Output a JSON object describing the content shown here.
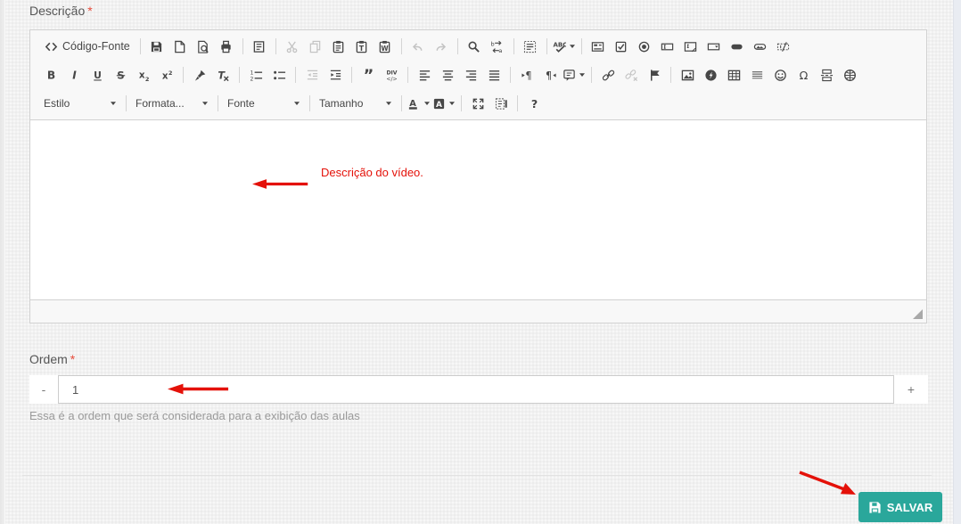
{
  "colors": {
    "accent_teal": "#2aa79b",
    "annotation_red": "#e41109",
    "required_red": "#e74c3c"
  },
  "description_field": {
    "label": "Descrição",
    "required_mark": "*"
  },
  "editor": {
    "annotation_text": "Descrição do vídeo.",
    "toolbar": {
      "rows": [
        [
          [
            {
              "name": "source",
              "label": "Código-Fonte"
            }
          ],
          [
            {
              "name": "save"
            },
            {
              "name": "new-page"
            },
            {
              "name": "preview"
            },
            {
              "name": "print"
            }
          ],
          [
            {
              "name": "templates"
            }
          ],
          [
            {
              "name": "cut",
              "disabled": true
            },
            {
              "name": "copy",
              "disabled": true
            },
            {
              "name": "paste"
            },
            {
              "name": "paste-text"
            },
            {
              "name": "paste-word"
            }
          ],
          [
            {
              "name": "undo",
              "disabled": true
            },
            {
              "name": "redo",
              "disabled": true
            }
          ],
          [
            {
              "name": "find"
            },
            {
              "name": "replace"
            }
          ],
          [
            {
              "name": "select-all"
            }
          ],
          [
            {
              "name": "spell-check",
              "caret": true
            }
          ],
          [
            {
              "name": "form"
            },
            {
              "name": "checkbox"
            },
            {
              "name": "radio"
            },
            {
              "name": "text-field"
            },
            {
              "name": "textarea"
            },
            {
              "name": "select-field"
            },
            {
              "name": "button-field"
            },
            {
              "name": "image-button"
            },
            {
              "name": "hidden-field"
            }
          ]
        ],
        [
          [
            {
              "name": "bold"
            },
            {
              "name": "italic"
            },
            {
              "name": "underline"
            },
            {
              "name": "strikethrough"
            },
            {
              "name": "subscript"
            },
            {
              "name": "superscript"
            }
          ],
          [
            {
              "name": "copy-formatting"
            },
            {
              "name": "remove-format"
            }
          ],
          [
            {
              "name": "numbered-list"
            },
            {
              "name": "bulleted-list"
            }
          ],
          [
            {
              "name": "outdent",
              "disabled": true
            },
            {
              "name": "indent"
            }
          ],
          [
            {
              "name": "blockquote"
            },
            {
              "name": "div-container"
            }
          ],
          [
            {
              "name": "align-left"
            },
            {
              "name": "align-center"
            },
            {
              "name": "align-right"
            },
            {
              "name": "justify"
            }
          ],
          [
            {
              "name": "bidi-ltr"
            },
            {
              "name": "bidi-rtl"
            },
            {
              "name": "language",
              "caret": true
            }
          ],
          [
            {
              "name": "link"
            },
            {
              "name": "unlink",
              "disabled": true
            },
            {
              "name": "anchor"
            }
          ],
          [
            {
              "name": "image"
            },
            {
              "name": "flash"
            },
            {
              "name": "table"
            },
            {
              "name": "horizontal-rule"
            },
            {
              "name": "smiley"
            },
            {
              "name": "special-char"
            },
            {
              "name": "page-break"
            },
            {
              "name": "iframe"
            }
          ]
        ],
        [
          [
            {
              "name": "style",
              "combo": "Estilo"
            }
          ],
          [
            {
              "name": "format",
              "combo": "Formata..."
            }
          ],
          [
            {
              "name": "font",
              "combo": "Fonte"
            }
          ],
          [
            {
              "name": "size",
              "combo": "Tamanho"
            }
          ],
          [
            {
              "name": "text-color",
              "caret": true
            },
            {
              "name": "bg-color",
              "caret": true
            }
          ],
          [
            {
              "name": "maximize"
            },
            {
              "name": "show-blocks"
            }
          ],
          [
            {
              "name": "about"
            }
          ]
        ]
      ]
    }
  },
  "order_field": {
    "label": "Ordem",
    "required_mark": "*",
    "value": "1",
    "decrement_label": "-",
    "increment_label": "+",
    "help_text": "Essa é a ordem que será considerada para a exibição das aulas"
  },
  "save_button": {
    "label": "SALVAR"
  }
}
